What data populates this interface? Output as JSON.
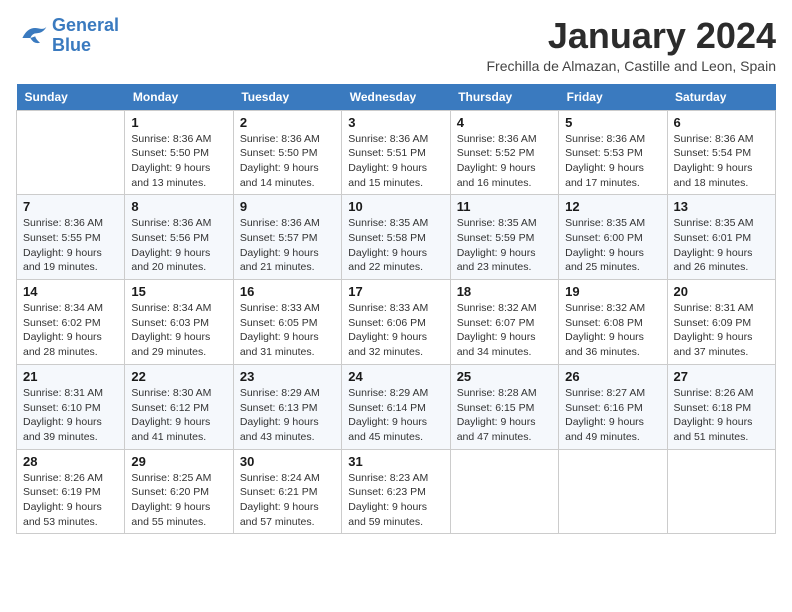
{
  "header": {
    "logo_line1": "General",
    "logo_line2": "Blue",
    "month_title": "January 2024",
    "location": "Frechilla de Almazan, Castille and Leon, Spain"
  },
  "weekdays": [
    "Sunday",
    "Monday",
    "Tuesday",
    "Wednesday",
    "Thursday",
    "Friday",
    "Saturday"
  ],
  "weeks": [
    [
      {
        "day": "",
        "info": ""
      },
      {
        "day": "1",
        "info": "Sunrise: 8:36 AM\nSunset: 5:50 PM\nDaylight: 9 hours\nand 13 minutes."
      },
      {
        "day": "2",
        "info": "Sunrise: 8:36 AM\nSunset: 5:50 PM\nDaylight: 9 hours\nand 14 minutes."
      },
      {
        "day": "3",
        "info": "Sunrise: 8:36 AM\nSunset: 5:51 PM\nDaylight: 9 hours\nand 15 minutes."
      },
      {
        "day": "4",
        "info": "Sunrise: 8:36 AM\nSunset: 5:52 PM\nDaylight: 9 hours\nand 16 minutes."
      },
      {
        "day": "5",
        "info": "Sunrise: 8:36 AM\nSunset: 5:53 PM\nDaylight: 9 hours\nand 17 minutes."
      },
      {
        "day": "6",
        "info": "Sunrise: 8:36 AM\nSunset: 5:54 PM\nDaylight: 9 hours\nand 18 minutes."
      }
    ],
    [
      {
        "day": "7",
        "info": "Sunrise: 8:36 AM\nSunset: 5:55 PM\nDaylight: 9 hours\nand 19 minutes."
      },
      {
        "day": "8",
        "info": "Sunrise: 8:36 AM\nSunset: 5:56 PM\nDaylight: 9 hours\nand 20 minutes."
      },
      {
        "day": "9",
        "info": "Sunrise: 8:36 AM\nSunset: 5:57 PM\nDaylight: 9 hours\nand 21 minutes."
      },
      {
        "day": "10",
        "info": "Sunrise: 8:35 AM\nSunset: 5:58 PM\nDaylight: 9 hours\nand 22 minutes."
      },
      {
        "day": "11",
        "info": "Sunrise: 8:35 AM\nSunset: 5:59 PM\nDaylight: 9 hours\nand 23 minutes."
      },
      {
        "day": "12",
        "info": "Sunrise: 8:35 AM\nSunset: 6:00 PM\nDaylight: 9 hours\nand 25 minutes."
      },
      {
        "day": "13",
        "info": "Sunrise: 8:35 AM\nSunset: 6:01 PM\nDaylight: 9 hours\nand 26 minutes."
      }
    ],
    [
      {
        "day": "14",
        "info": "Sunrise: 8:34 AM\nSunset: 6:02 PM\nDaylight: 9 hours\nand 28 minutes."
      },
      {
        "day": "15",
        "info": "Sunrise: 8:34 AM\nSunset: 6:03 PM\nDaylight: 9 hours\nand 29 minutes."
      },
      {
        "day": "16",
        "info": "Sunrise: 8:33 AM\nSunset: 6:05 PM\nDaylight: 9 hours\nand 31 minutes."
      },
      {
        "day": "17",
        "info": "Sunrise: 8:33 AM\nSunset: 6:06 PM\nDaylight: 9 hours\nand 32 minutes."
      },
      {
        "day": "18",
        "info": "Sunrise: 8:32 AM\nSunset: 6:07 PM\nDaylight: 9 hours\nand 34 minutes."
      },
      {
        "day": "19",
        "info": "Sunrise: 8:32 AM\nSunset: 6:08 PM\nDaylight: 9 hours\nand 36 minutes."
      },
      {
        "day": "20",
        "info": "Sunrise: 8:31 AM\nSunset: 6:09 PM\nDaylight: 9 hours\nand 37 minutes."
      }
    ],
    [
      {
        "day": "21",
        "info": "Sunrise: 8:31 AM\nSunset: 6:10 PM\nDaylight: 9 hours\nand 39 minutes."
      },
      {
        "day": "22",
        "info": "Sunrise: 8:30 AM\nSunset: 6:12 PM\nDaylight: 9 hours\nand 41 minutes."
      },
      {
        "day": "23",
        "info": "Sunrise: 8:29 AM\nSunset: 6:13 PM\nDaylight: 9 hours\nand 43 minutes."
      },
      {
        "day": "24",
        "info": "Sunrise: 8:29 AM\nSunset: 6:14 PM\nDaylight: 9 hours\nand 45 minutes."
      },
      {
        "day": "25",
        "info": "Sunrise: 8:28 AM\nSunset: 6:15 PM\nDaylight: 9 hours\nand 47 minutes."
      },
      {
        "day": "26",
        "info": "Sunrise: 8:27 AM\nSunset: 6:16 PM\nDaylight: 9 hours\nand 49 minutes."
      },
      {
        "day": "27",
        "info": "Sunrise: 8:26 AM\nSunset: 6:18 PM\nDaylight: 9 hours\nand 51 minutes."
      }
    ],
    [
      {
        "day": "28",
        "info": "Sunrise: 8:26 AM\nSunset: 6:19 PM\nDaylight: 9 hours\nand 53 minutes."
      },
      {
        "day": "29",
        "info": "Sunrise: 8:25 AM\nSunset: 6:20 PM\nDaylight: 9 hours\nand 55 minutes."
      },
      {
        "day": "30",
        "info": "Sunrise: 8:24 AM\nSunset: 6:21 PM\nDaylight: 9 hours\nand 57 minutes."
      },
      {
        "day": "31",
        "info": "Sunrise: 8:23 AM\nSunset: 6:23 PM\nDaylight: 9 hours\nand 59 minutes."
      },
      {
        "day": "",
        "info": ""
      },
      {
        "day": "",
        "info": ""
      },
      {
        "day": "",
        "info": ""
      }
    ]
  ]
}
